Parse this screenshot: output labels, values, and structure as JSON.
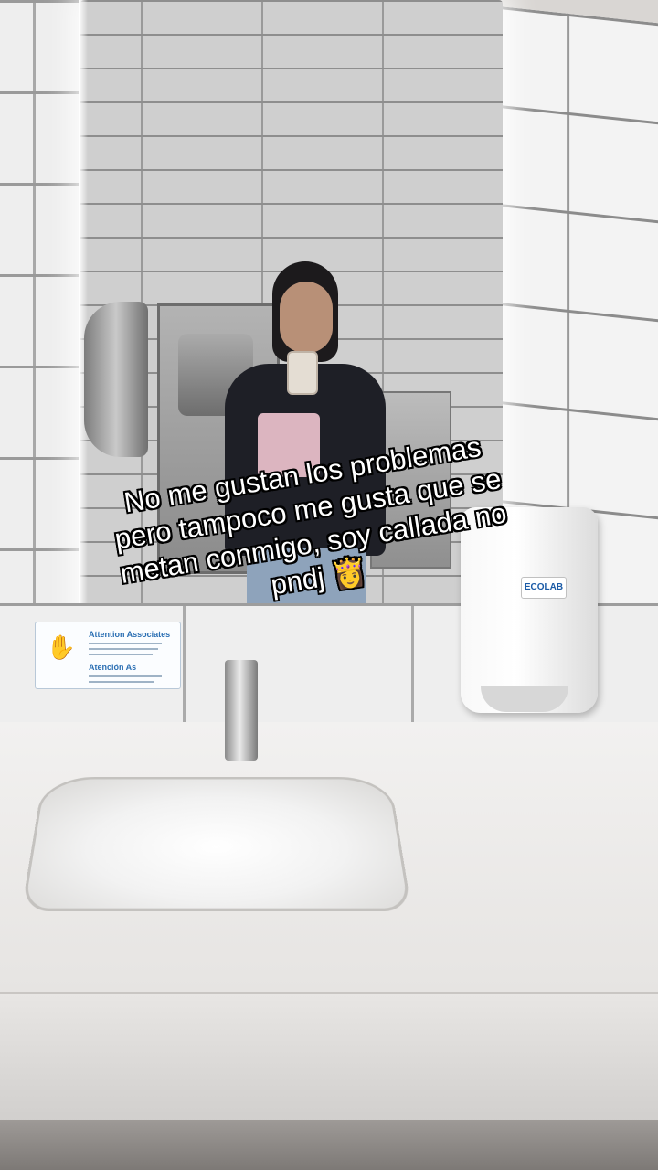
{
  "caption": {
    "text": "No me gustan los problemas pero tampoco me gusta que se metan conmigo, soy callada no pndj 👸"
  },
  "sign": {
    "title_en": "Attention Associates",
    "title_es": "Atención As"
  },
  "soap_dispenser": {
    "brand": "ECOLAB"
  },
  "colors": {
    "caption_text": "#ffffff",
    "caption_outline": "#000000",
    "sign_accent": "#2b6fb3"
  }
}
